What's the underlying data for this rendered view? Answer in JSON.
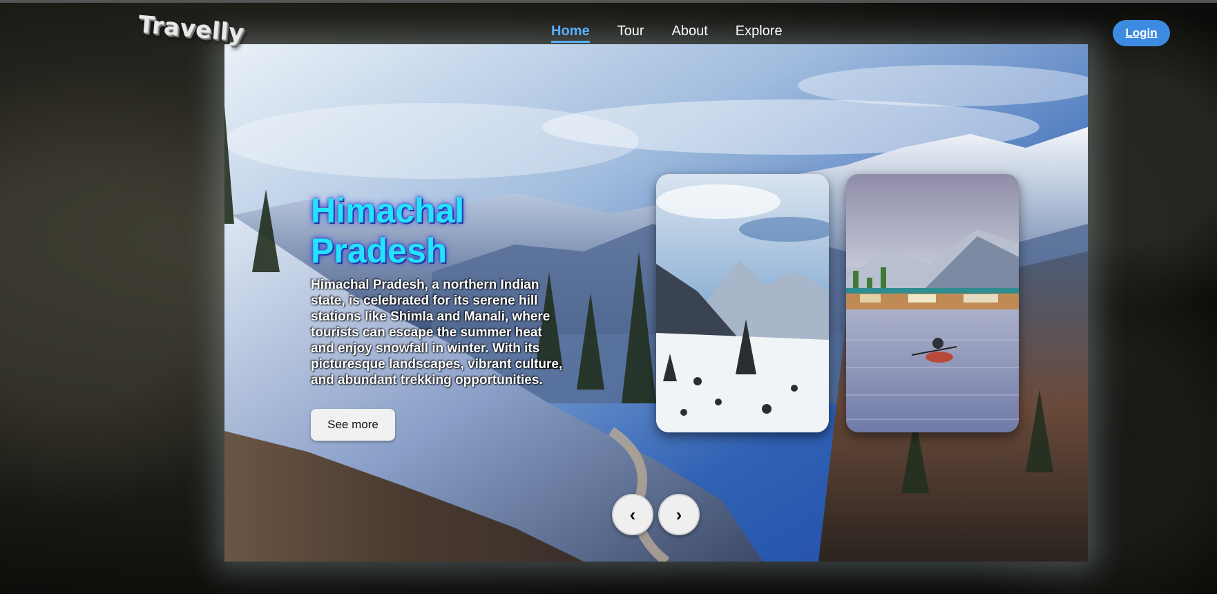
{
  "header": {
    "logo": "Travelly",
    "nav": [
      {
        "label": "Home",
        "active": true
      },
      {
        "label": "Tour",
        "active": false
      },
      {
        "label": "About",
        "active": false
      },
      {
        "label": "Explore",
        "active": false
      }
    ],
    "login_label": "Login"
  },
  "hero": {
    "title": "Himachal Pradesh",
    "description": "Himachal Pradesh, a northern Indian state, is celebrated for its serene hill stations like Shimla and Manali, where tourists can escape the summer heat and enjoy snowfall in winter. With its picturesque landscapes, vibrant culture, and abundant trekking opportunities.",
    "cta_label": "See more",
    "prev_icon": "‹",
    "next_icon": "›"
  },
  "colors": {
    "accent": "#5ab0ff",
    "login_bg": "#3d8be0",
    "title": "#22e4ff"
  },
  "icons": {
    "prev": "chevron-left-icon",
    "next": "chevron-right-icon"
  }
}
